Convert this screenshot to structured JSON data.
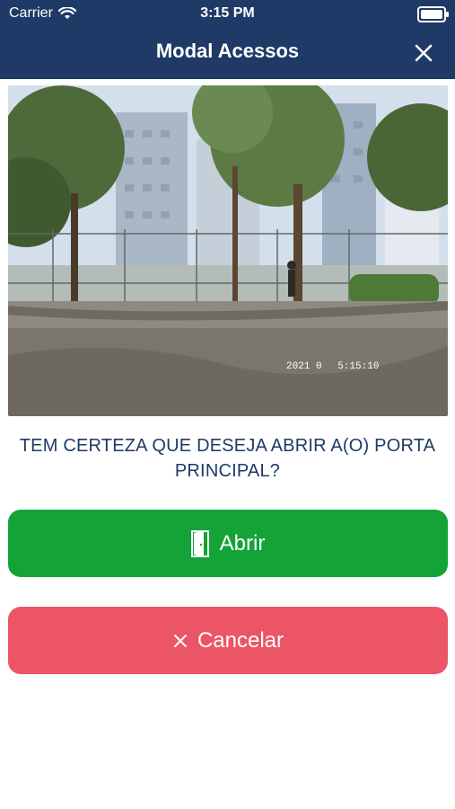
{
  "status_bar": {
    "carrier": "Carrier",
    "time": "3:15 PM"
  },
  "header": {
    "title": "Modal Acessos",
    "close_icon": "close-icon"
  },
  "camera": {
    "timestamp": "2021 0        5:15:10"
  },
  "prompt": {
    "text": "TEM CERTEZA QUE DESEJA ABRIR A(O) PORTA PRINCIPAL?"
  },
  "actions": {
    "open": {
      "label": "Abrir",
      "icon": "door-icon",
      "color": "#13a337"
    },
    "cancel": {
      "label": "Cancelar",
      "icon": "close-icon",
      "color": "#eb5565"
    }
  },
  "colors": {
    "header": "#1f3a66",
    "prompt_text": "#1f3a66"
  }
}
